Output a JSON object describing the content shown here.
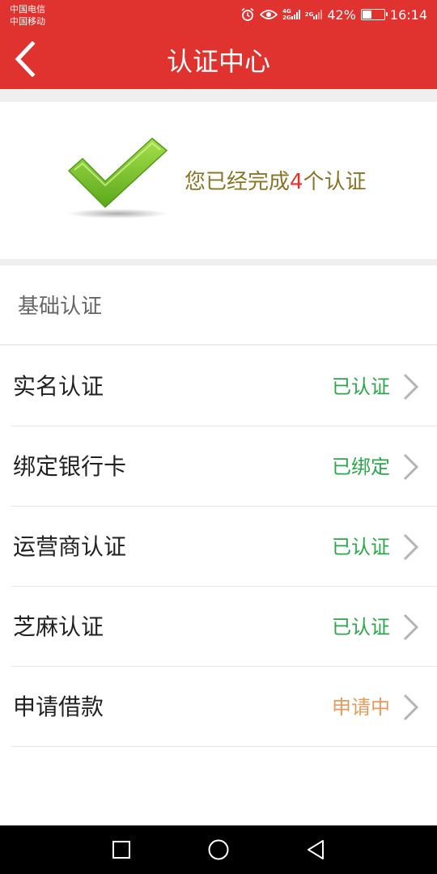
{
  "status_bar": {
    "carrier1": "中国电信",
    "carrier2": "中国移动",
    "net1": "4G",
    "net1b": "2G",
    "net2": "2G",
    "battery_percent": "42%",
    "battery_level": 0.42,
    "time": "16:14",
    "icons": [
      "alarm-icon",
      "eye-icon",
      "signal-icon",
      "battery-icon"
    ]
  },
  "header": {
    "title": "认证中心",
    "background": "#e0322e",
    "back_icon": "chevron-left-icon"
  },
  "summary": {
    "prefix": "您已经完成",
    "count": "4",
    "suffix": "个认证",
    "icon": "checkmark-icon"
  },
  "section": {
    "title": "基础认证"
  },
  "items": [
    {
      "label": "实名认证",
      "status": "已认证",
      "status_color": "#2aa84a"
    },
    {
      "label": "绑定银行卡",
      "status": "已绑定",
      "status_color": "#2aa84a"
    },
    {
      "label": "运营商认证",
      "status": "已认证",
      "status_color": "#2aa84a"
    },
    {
      "label": "芝麻认证",
      "status": "已认证",
      "status_color": "#2aa84a"
    },
    {
      "label": "申请借款",
      "status": "申请中",
      "status_color": "#e89a5a"
    }
  ],
  "nav": {
    "icons": [
      "recent-apps-icon",
      "home-icon",
      "back-icon"
    ]
  }
}
